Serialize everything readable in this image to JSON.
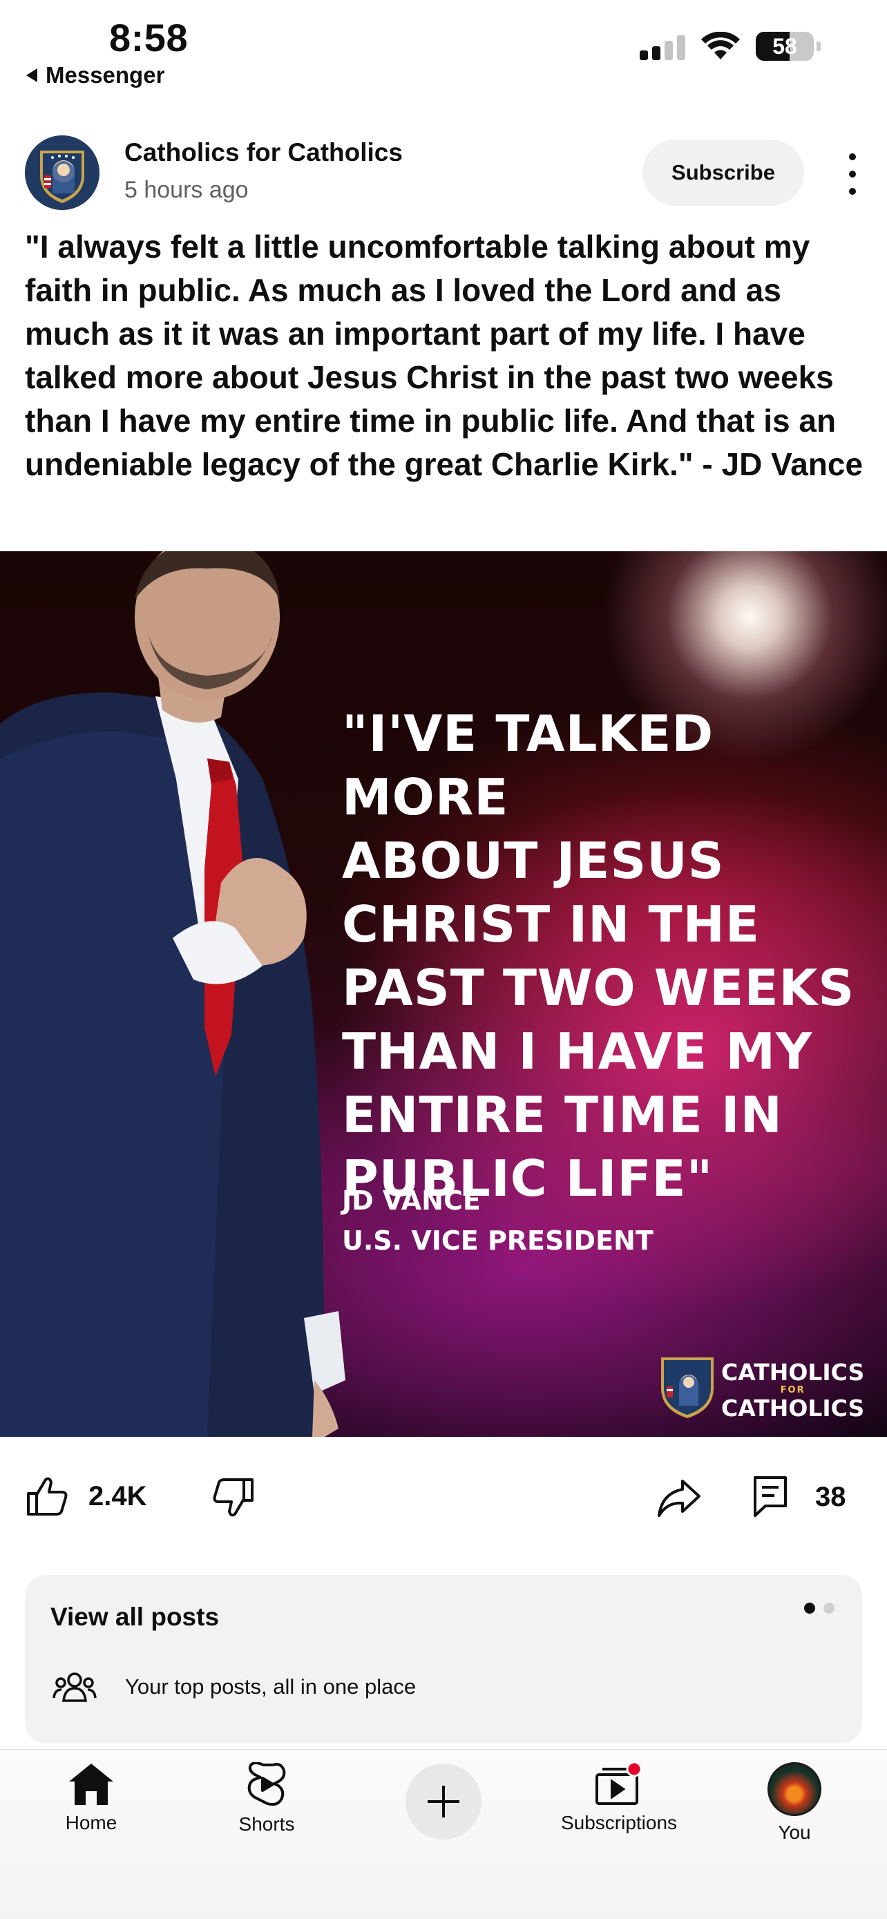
{
  "status_bar": {
    "time": "8:58",
    "back_label": "Messenger",
    "battery": "58",
    "battery_level": 0.58,
    "signal_bars_active": 2
  },
  "post": {
    "channel_name": "Catholics for Catholics",
    "time_ago": "5 hours ago",
    "subscribe_label": "Subscribe",
    "text": "\"I always felt a little uncomfortable talking about my faith in public. As much as I loved the Lord and as much as it it was an important part of my life. I have talked more about Jesus Christ in the past two weeks than I have my entire time in public life. And that is an undeniable legacy of the great Charlie Kirk.\" - JD Vance"
  },
  "image": {
    "quote_lines": [
      "\"I'VE TALKED MORE",
      "ABOUT JESUS",
      "CHRIST IN THE",
      "PAST TWO WEEKS",
      "THAN I HAVE MY",
      "ENTIRE TIME IN",
      "PUBLIC LIFE\""
    ],
    "attribution_name": "JD VANCE",
    "attribution_title": "U.S. VICE PRESIDENT",
    "watermark_top": "CATHOLICS",
    "watermark_mid": "FOR",
    "watermark_bottom": "CATHOLICS"
  },
  "actions": {
    "like_count": "2.4K",
    "comment_count": "38",
    "icons": [
      "like-icon",
      "dislike-icon",
      "share-icon",
      "comment-icon"
    ]
  },
  "view_all_card": {
    "title": "View all posts",
    "subtitle": "Your top posts, all in one place",
    "page_index": 0,
    "page_count": 2
  },
  "bottom_nav": {
    "items": [
      {
        "label": "Home",
        "icon": "home-icon"
      },
      {
        "label": "Shorts",
        "icon": "shorts-icon"
      },
      {
        "label": "",
        "icon": "create-plus-icon"
      },
      {
        "label": "Subscriptions",
        "icon": "subscriptions-icon"
      },
      {
        "label": "You",
        "icon": "avatar"
      }
    ]
  },
  "colors": {
    "accent_red": "#e4002b",
    "text": "#0f0f0f",
    "secondary_text": "#606060",
    "chip_bg": "#f1f1f1"
  }
}
